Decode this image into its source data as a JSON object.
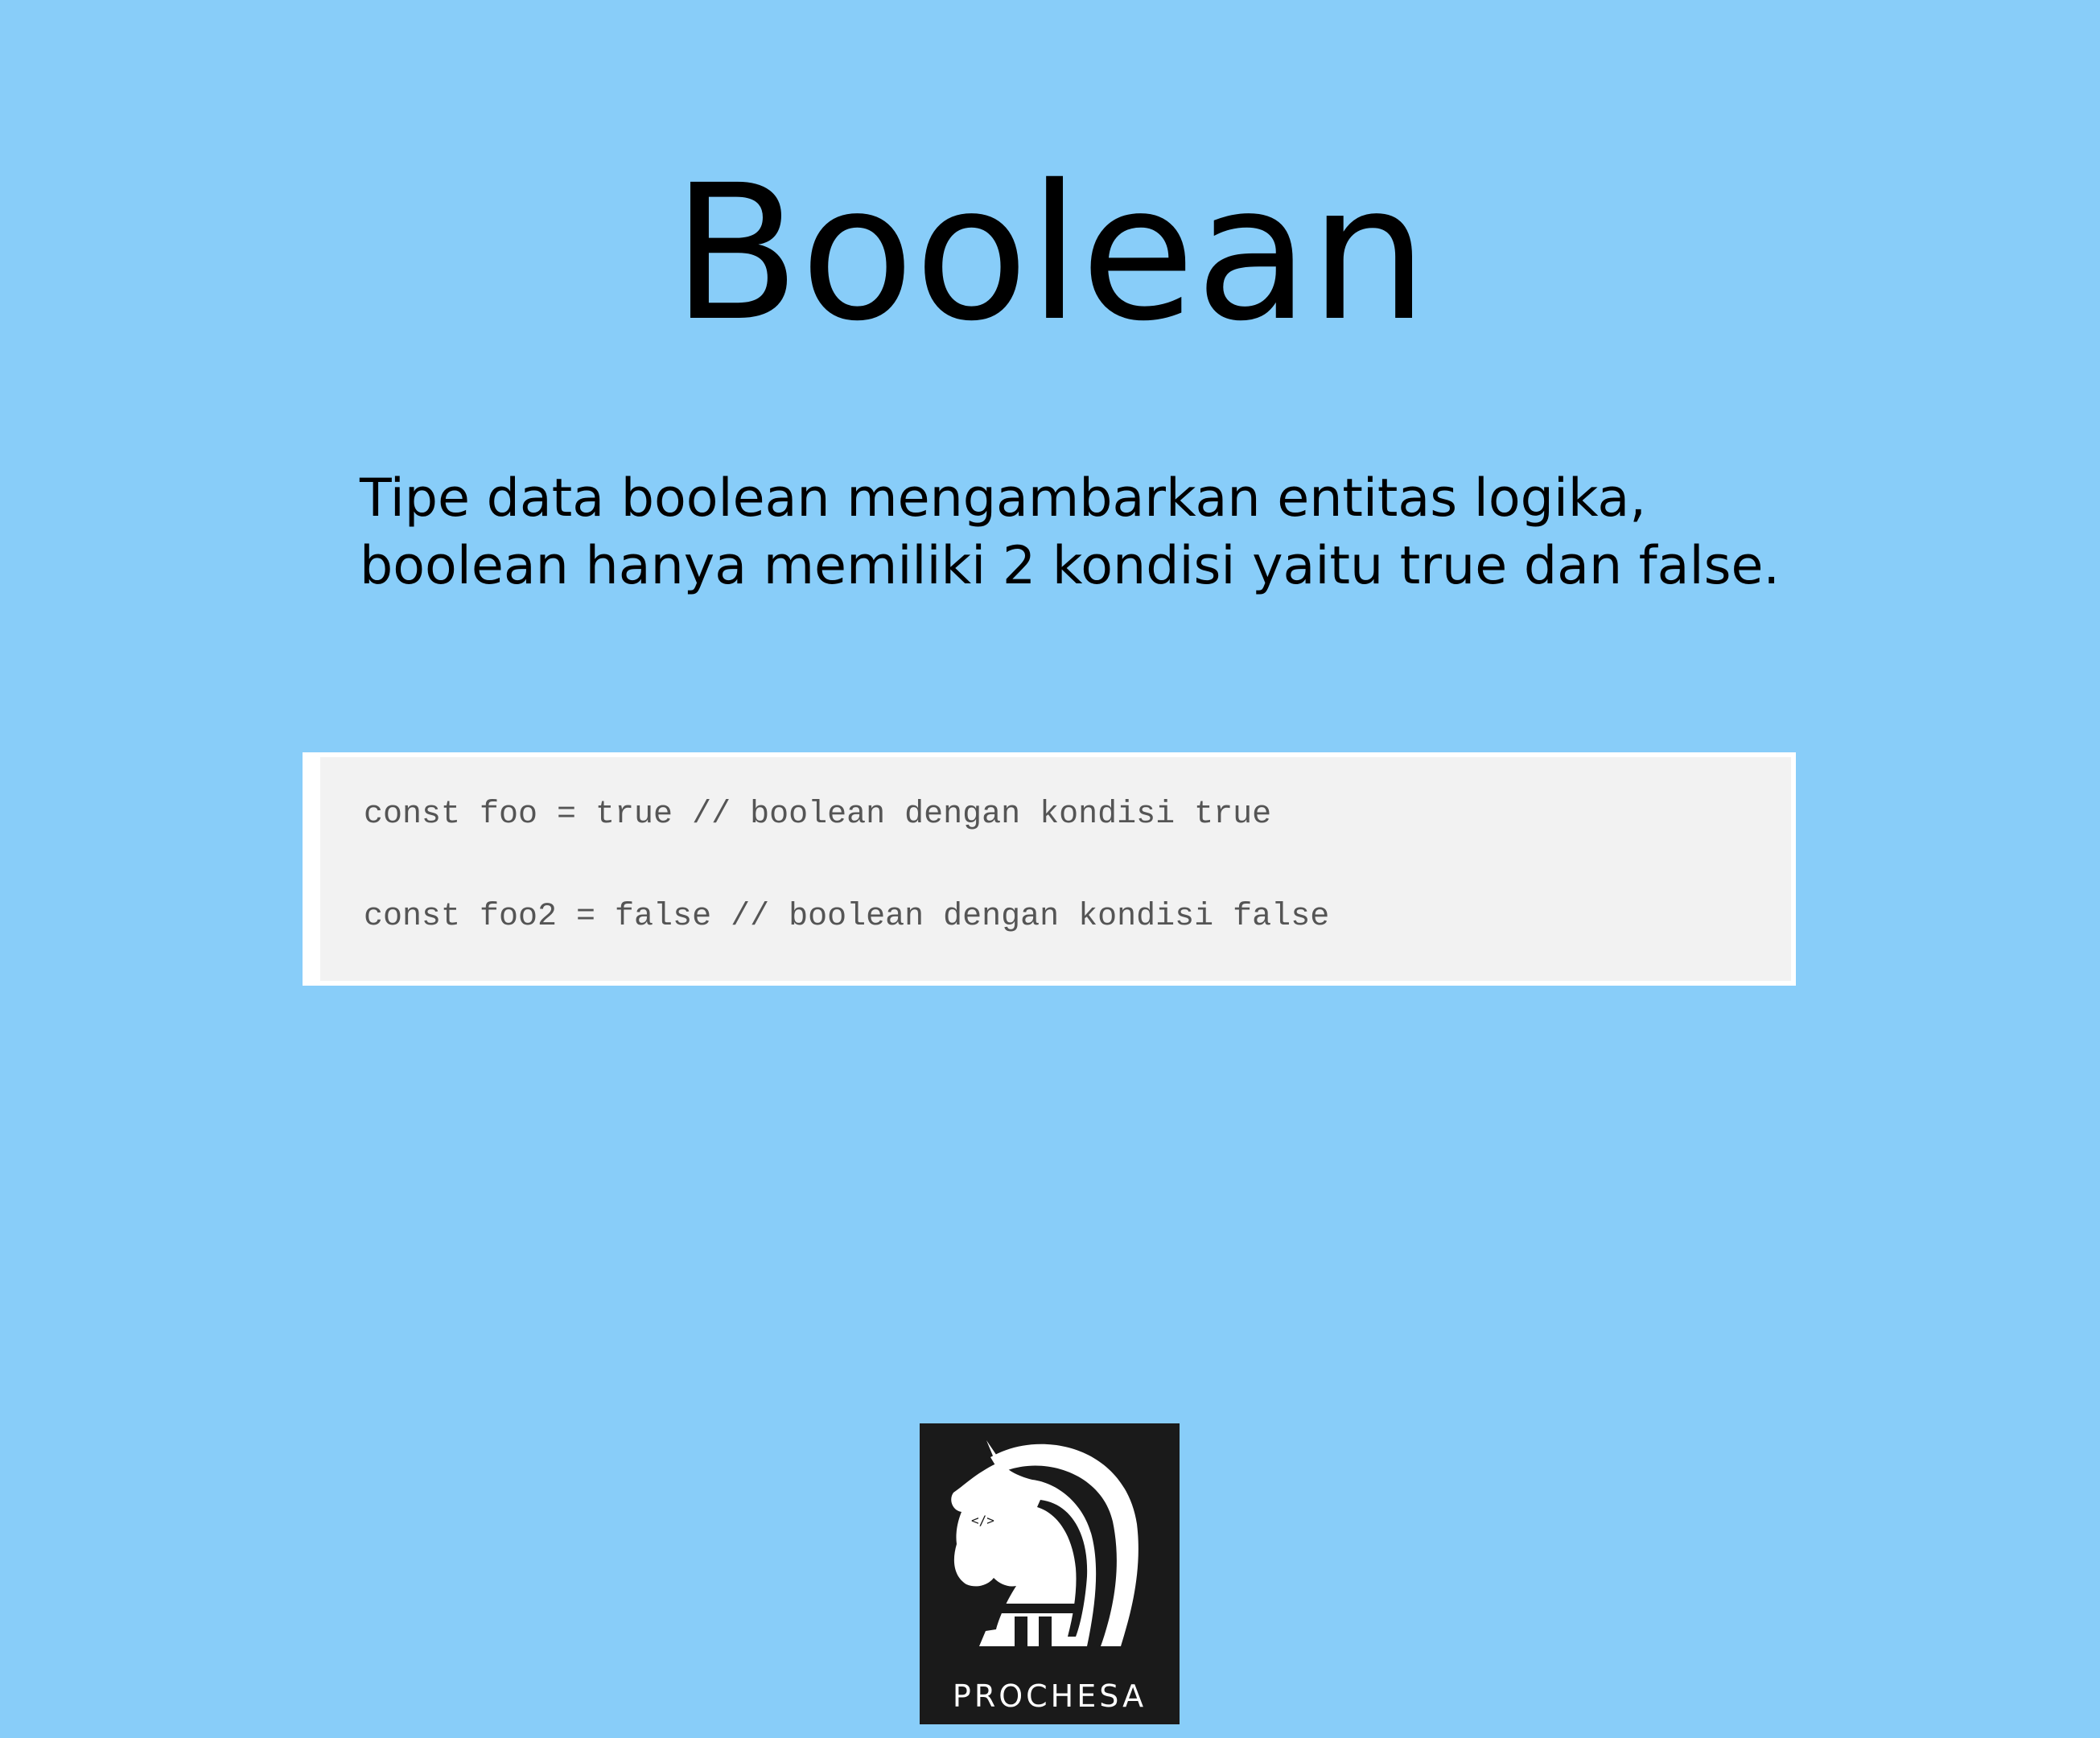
{
  "slide": {
    "title": "Boolean",
    "description": {
      "line1": "Tipe data boolean mengambarkan entitas logika,",
      "line2": "boolean hanya memiliki 2 kondisi yaitu true dan false."
    },
    "code": {
      "line1": "const foo = true // boolean dengan kondisi true",
      "line2": "const foo2 = false // boolean dengan kondisi false"
    }
  },
  "logo": {
    "icon": "knight-horse-icon",
    "text": "PROCHESA",
    "eye_text": "</>"
  },
  "colors": {
    "background": "#88cdf9",
    "code_background": "#f2f2f2",
    "code_border": "#ffffff",
    "code_text": "#555555",
    "logo_background": "#1a1a1a"
  }
}
